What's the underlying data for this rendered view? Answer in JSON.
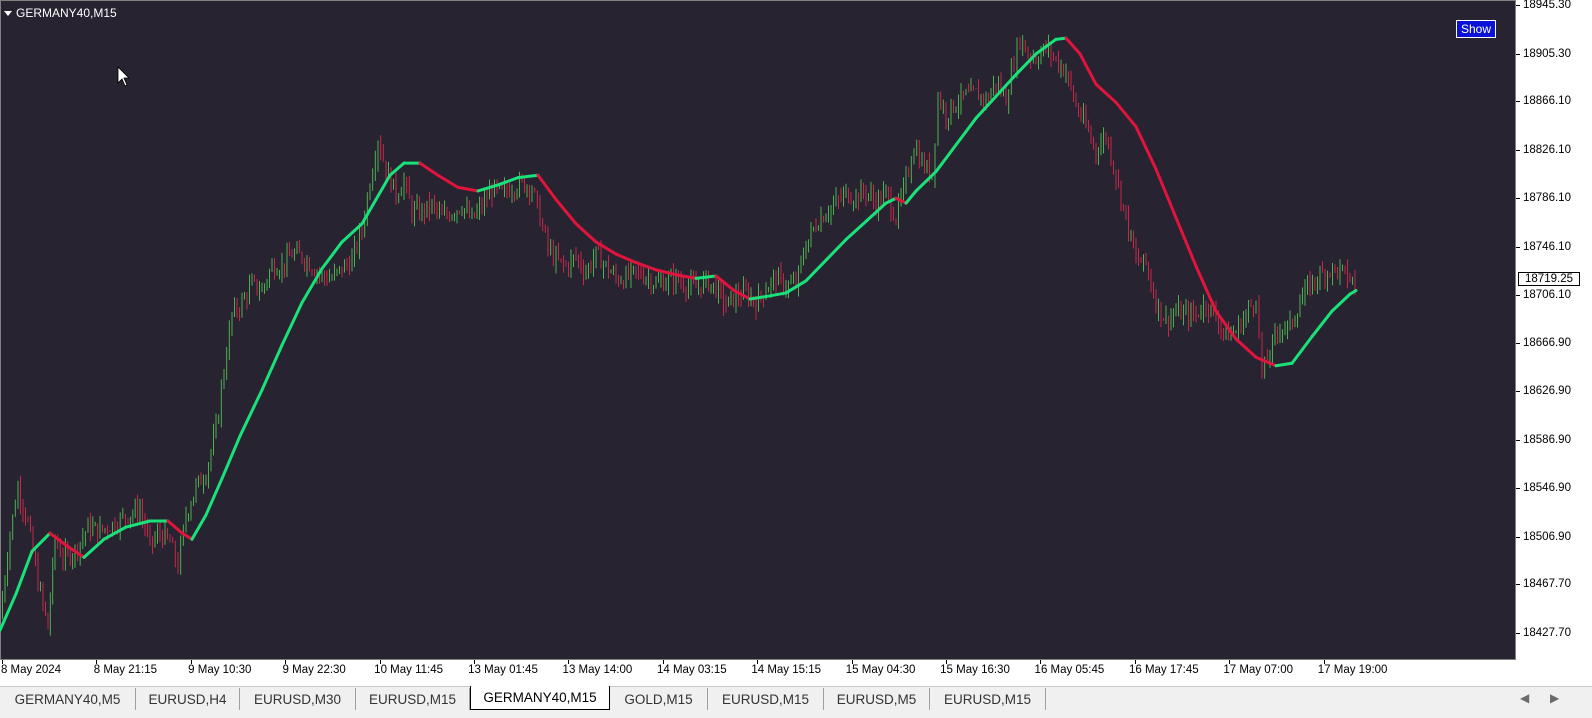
{
  "window": {
    "symbol_label": "GERMANY40,M15",
    "show_button": "Show"
  },
  "colors": {
    "background": "#272330",
    "bull_line": "#19e27a",
    "bear_line": "#e0143c",
    "bull_candle": "#4caf50",
    "bear_candle": "#c62848"
  },
  "chart_data": {
    "type": "candlestick-with-trend-line",
    "symbol": "GERMANY40",
    "timeframe": "M15",
    "ylim": [
      18427.7,
      18945.3
    ],
    "y_ticks": [
      "18945.30",
      "18905.30",
      "18866.10",
      "18826.10",
      "18786.10",
      "18746.10",
      "18706.10",
      "18666.90",
      "18626.90",
      "18586.90",
      "18546.90",
      "18506.90",
      "18467.70",
      "18427.70"
    ],
    "x_ticks": [
      "8 May 2024",
      "8 May 21:15",
      "9 May 10:30",
      "9 May 22:30",
      "10 May 11:45",
      "13 May 01:45",
      "13 May 14:00",
      "14 May 03:15",
      "14 May 15:15",
      "15 May 04:30",
      "15 May 16:30",
      "16 May 05:45",
      "16 May 17:45",
      "17 May 07:00",
      "17 May 19:00"
    ],
    "current_price": "18719.25",
    "price_path": [
      [
        0,
        18440
      ],
      [
        10,
        18510
      ],
      [
        18,
        18548
      ],
      [
        28,
        18518
      ],
      [
        38,
        18470
      ],
      [
        48,
        18432
      ],
      [
        55,
        18505
      ],
      [
        63,
        18490
      ],
      [
        75,
        18495
      ],
      [
        88,
        18515
      ],
      [
        100,
        18512
      ],
      [
        115,
        18518
      ],
      [
        128,
        18525
      ],
      [
        140,
        18530
      ],
      [
        150,
        18500
      ],
      [
        160,
        18510
      ],
      [
        170,
        18502
      ],
      [
        178,
        18483
      ],
      [
        186,
        18525
      ],
      [
        196,
        18548
      ],
      [
        206,
        18560
      ],
      [
        216,
        18595
      ],
      [
        224,
        18645
      ],
      [
        232,
        18690
      ],
      [
        242,
        18700
      ],
      [
        252,
        18715
      ],
      [
        262,
        18710
      ],
      [
        272,
        18730
      ],
      [
        282,
        18730
      ],
      [
        292,
        18740
      ],
      [
        302,
        18738
      ],
      [
        312,
        18730
      ],
      [
        322,
        18722
      ],
      [
        332,
        18720
      ],
      [
        342,
        18728
      ],
      [
        352,
        18735
      ],
      [
        362,
        18760
      ],
      [
        370,
        18800
      ],
      [
        378,
        18835
      ],
      [
        386,
        18810
      ],
      [
        396,
        18790
      ],
      [
        404,
        18800
      ],
      [
        412,
        18775
      ],
      [
        422,
        18775
      ],
      [
        432,
        18780
      ],
      [
        442,
        18770
      ],
      [
        452,
        18775
      ],
      [
        462,
        18780
      ],
      [
        472,
        18768
      ],
      [
        482,
        18780
      ],
      [
        492,
        18793
      ],
      [
        502,
        18790
      ],
      [
        512,
        18795
      ],
      [
        522,
        18798
      ],
      [
        532,
        18795
      ],
      [
        540,
        18770
      ],
      [
        548,
        18745
      ],
      [
        556,
        18735
      ],
      [
        566,
        18730
      ],
      [
        576,
        18738
      ],
      [
        586,
        18725
      ],
      [
        596,
        18740
      ],
      [
        606,
        18730
      ],
      [
        616,
        18720
      ],
      [
        626,
        18720
      ],
      [
        636,
        18725
      ],
      [
        646,
        18722
      ],
      [
        656,
        18715
      ],
      [
        666,
        18718
      ],
      [
        676,
        18720
      ],
      [
        686,
        18715
      ],
      [
        696,
        18712
      ],
      [
        706,
        18718
      ],
      [
        716,
        18712
      ],
      [
        726,
        18698
      ],
      [
        736,
        18705
      ],
      [
        746,
        18708
      ],
      [
        756,
        18700
      ],
      [
        766,
        18712
      ],
      [
        776,
        18720
      ],
      [
        786,
        18714
      ],
      [
        796,
        18715
      ],
      [
        806,
        18748
      ],
      [
        816,
        18765
      ],
      [
        826,
        18775
      ],
      [
        836,
        18782
      ],
      [
        846,
        18790
      ],
      [
        856,
        18787
      ],
      [
        866,
        18792
      ],
      [
        876,
        18782
      ],
      [
        886,
        18790
      ],
      [
        896,
        18770
      ],
      [
        906,
        18800
      ],
      [
        914,
        18830
      ],
      [
        922,
        18815
      ],
      [
        932,
        18805
      ],
      [
        938,
        18870
      ],
      [
        946,
        18855
      ],
      [
        956,
        18865
      ],
      [
        966,
        18870
      ],
      [
        976,
        18872
      ],
      [
        986,
        18867
      ],
      [
        996,
        18882
      ],
      [
        1006,
        18868
      ],
      [
        1014,
        18900
      ],
      [
        1020,
        18918
      ],
      [
        1028,
        18905
      ],
      [
        1036,
        18902
      ],
      [
        1046,
        18910
      ],
      [
        1056,
        18900
      ],
      [
        1066,
        18890
      ],
      [
        1076,
        18862
      ],
      [
        1086,
        18845
      ],
      [
        1096,
        18825
      ],
      [
        1106,
        18838
      ],
      [
        1116,
        18805
      ],
      [
        1126,
        18770
      ],
      [
        1136,
        18735
      ],
      [
        1146,
        18732
      ],
      [
        1156,
        18700
      ],
      [
        1166,
        18685
      ],
      [
        1176,
        18692
      ],
      [
        1186,
        18690
      ],
      [
        1196,
        18690
      ],
      [
        1206,
        18700
      ],
      [
        1216,
        18688
      ],
      [
        1226,
        18673
      ],
      [
        1236,
        18676
      ],
      [
        1246,
        18690
      ],
      [
        1256,
        18705
      ],
      [
        1262,
        18640
      ],
      [
        1270,
        18660
      ],
      [
        1280,
        18680
      ],
      [
        1290,
        18680
      ],
      [
        1300,
        18700
      ],
      [
        1310,
        18715
      ],
      [
        1320,
        18722
      ],
      [
        1330,
        18727
      ],
      [
        1340,
        18726
      ],
      [
        1350,
        18720
      ],
      [
        1355,
        18714
      ]
    ],
    "trend_line": [
      [
        0,
        18430,
        "bull"
      ],
      [
        16,
        18460,
        "bull"
      ],
      [
        32,
        18495,
        "bull"
      ],
      [
        50,
        18510,
        "bull"
      ],
      [
        66,
        18500,
        "bear"
      ],
      [
        84,
        18490,
        "bear"
      ],
      [
        104,
        18505,
        "bull"
      ],
      [
        126,
        18515,
        "bull"
      ],
      [
        150,
        18520,
        "bull"
      ],
      [
        168,
        18520,
        "bull"
      ],
      [
        182,
        18510,
        "bear"
      ],
      [
        192,
        18505,
        "bear"
      ],
      [
        206,
        18525,
        "bull"
      ],
      [
        222,
        18555,
        "bull"
      ],
      [
        240,
        18590,
        "bull"
      ],
      [
        262,
        18628,
        "bull"
      ],
      [
        282,
        18665,
        "bull"
      ],
      [
        302,
        18700,
        "bull"
      ],
      [
        322,
        18728,
        "bull"
      ],
      [
        342,
        18750,
        "bull"
      ],
      [
        362,
        18765,
        "bull"
      ],
      [
        376,
        18785,
        "bull"
      ],
      [
        390,
        18805,
        "bull"
      ],
      [
        404,
        18815,
        "bull"
      ],
      [
        420,
        18815,
        "bull"
      ],
      [
        438,
        18805,
        "bear"
      ],
      [
        458,
        18795,
        "bear"
      ],
      [
        478,
        18792,
        "bear"
      ],
      [
        498,
        18797,
        "bull"
      ],
      [
        518,
        18803,
        "bull"
      ],
      [
        538,
        18805,
        "bull"
      ],
      [
        556,
        18785,
        "bear"
      ],
      [
        576,
        18765,
        "bear"
      ],
      [
        596,
        18750,
        "bear"
      ],
      [
        616,
        18740,
        "bear"
      ],
      [
        636,
        18733,
        "bear"
      ],
      [
        656,
        18727,
        "bear"
      ],
      [
        676,
        18723,
        "bear"
      ],
      [
        696,
        18720,
        "bear"
      ],
      [
        716,
        18722,
        "bull"
      ],
      [
        734,
        18710,
        "bear"
      ],
      [
        750,
        18703,
        "bear"
      ],
      [
        766,
        18705,
        "bull"
      ],
      [
        786,
        18708,
        "bull"
      ],
      [
        806,
        18718,
        "bull"
      ],
      [
        826,
        18735,
        "bull"
      ],
      [
        846,
        18752,
        "bull"
      ],
      [
        866,
        18767,
        "bull"
      ],
      [
        886,
        18782,
        "bull"
      ],
      [
        896,
        18786,
        "bull"
      ],
      [
        906,
        18782,
        "bear"
      ],
      [
        916,
        18792,
        "bull"
      ],
      [
        936,
        18808,
        "bull"
      ],
      [
        956,
        18830,
        "bull"
      ],
      [
        976,
        18852,
        "bull"
      ],
      [
        996,
        18870,
        "bull"
      ],
      [
        1016,
        18888,
        "bull"
      ],
      [
        1036,
        18905,
        "bull"
      ],
      [
        1056,
        18917,
        "bull"
      ],
      [
        1066,
        18918,
        "bull"
      ],
      [
        1080,
        18905,
        "bear"
      ],
      [
        1096,
        18880,
        "bear"
      ],
      [
        1116,
        18865,
        "bear"
      ],
      [
        1136,
        18845,
        "bear"
      ],
      [
        1156,
        18810,
        "bear"
      ],
      [
        1176,
        18770,
        "bear"
      ],
      [
        1196,
        18730,
        "bear"
      ],
      [
        1216,
        18693,
        "bear"
      ],
      [
        1236,
        18670,
        "bear"
      ],
      [
        1256,
        18655,
        "bear"
      ],
      [
        1276,
        18648,
        "bear"
      ],
      [
        1292,
        18650,
        "bull"
      ],
      [
        1312,
        18672,
        "bull"
      ],
      [
        1332,
        18693,
        "bull"
      ],
      [
        1350,
        18707,
        "bull"
      ],
      [
        1356,
        18710,
        "bull"
      ]
    ]
  },
  "tabs": [
    {
      "label": "GERMANY40,M5",
      "active": false
    },
    {
      "label": "EURUSD,H4",
      "active": false
    },
    {
      "label": "EURUSD,M30",
      "active": false
    },
    {
      "label": "EURUSD,M15",
      "active": false
    },
    {
      "label": "GERMANY40,M15",
      "active": true
    },
    {
      "label": "GOLD,M15",
      "active": false
    },
    {
      "label": "EURUSD,M15",
      "active": false
    },
    {
      "label": "EURUSD,M5",
      "active": false
    },
    {
      "label": "EURUSD,M15",
      "active": false
    }
  ],
  "tab_nav": {
    "left": "◀",
    "right": "▶"
  }
}
